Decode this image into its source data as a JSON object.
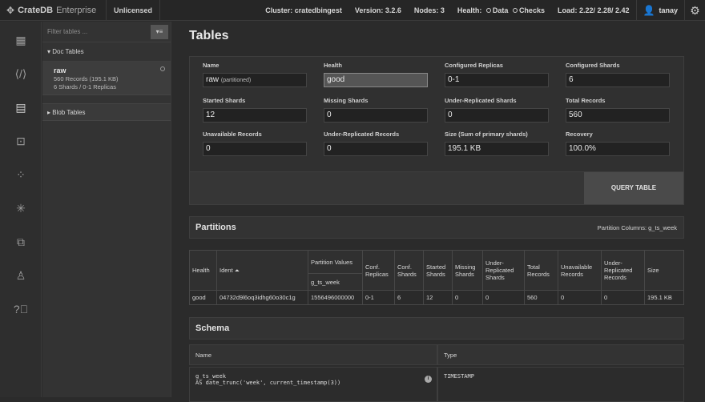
{
  "topbar": {
    "brand": "CrateDB",
    "edition": "Enterprise",
    "license": "Unlicensed",
    "cluster": "Cluster: cratedbingest",
    "version": "Version: 3.2.6",
    "nodes": "Nodes: 3",
    "health_label": "Health:",
    "health_data": "Data",
    "health_checks": "Checks",
    "load": "Load: 2.22/ 2.28/ 2.42",
    "user": "tanay"
  },
  "sidebar": {
    "filter_placeholder": "Filter tables ...",
    "filter_button": "▾≡",
    "doc_tables": "▾ Doc Tables",
    "table": {
      "name": "raw",
      "records": "560 Records (195.1 KB)",
      "shards": "6 Shards / 0-1 Replicas"
    },
    "blob_tables": "▸ Blob Tables"
  },
  "main": {
    "title": "Tables",
    "fields": [
      {
        "label": "Name",
        "value": "raw",
        "extra": "(partitioned)"
      },
      {
        "label": "Health",
        "value": "good"
      },
      {
        "label": "Configured Replicas",
        "value": "0-1"
      },
      {
        "label": "Configured Shards",
        "value": "6"
      },
      {
        "label": "Started Shards",
        "value": "12"
      },
      {
        "label": "Missing Shards",
        "value": "0"
      },
      {
        "label": "Under-Replicated Shards",
        "value": "0"
      },
      {
        "label": "Total Records",
        "value": "560"
      },
      {
        "label": "Unavailable Records",
        "value": "0"
      },
      {
        "label": "Under-Replicated Records",
        "value": "0"
      },
      {
        "label": "Size (Sum of primary shards)",
        "value": "195.1 KB"
      },
      {
        "label": "Recovery",
        "value": "100.0%"
      }
    ],
    "query_button": "QUERY TABLE",
    "partitions": {
      "title": "Partitions",
      "columns_label": "Partition Columns: g_ts_week",
      "headers": {
        "health": "Health",
        "ident": "Ident ⏶",
        "partition_values": "Partition Values",
        "sub_col": "g_ts_week",
        "conf_replicas": "Conf. Replicas",
        "conf_shards": "Conf. Shards",
        "started_shards": "Started Shards",
        "missing_shards": "Missing Shards",
        "under_rep_shards": "Under-Replicated Shards",
        "total_records": "Total Records",
        "unavailable_records": "Unavailable Records",
        "under_rep_records": "Under-Replicated Records",
        "size": "Size"
      },
      "row": {
        "health": "good",
        "ident": "04732d9l6oq3idhg60o30c1g",
        "g_ts_week": "1556496000000",
        "conf_replicas": "0-1",
        "conf_shards": "6",
        "started_shards": "12",
        "missing_shards": "0",
        "under_rep_shards": "0",
        "total_records": "560",
        "unavailable_records": "0",
        "under_rep_records": "0",
        "size": "195.1 KB"
      }
    },
    "schema": {
      "title": "Schema",
      "col_name": "Name",
      "col_type": "Type",
      "row_name": "g_ts_week",
      "row_expr": "AS date_trunc('week', current_timestamp(3))",
      "row_type": "TIMESTAMP"
    }
  }
}
